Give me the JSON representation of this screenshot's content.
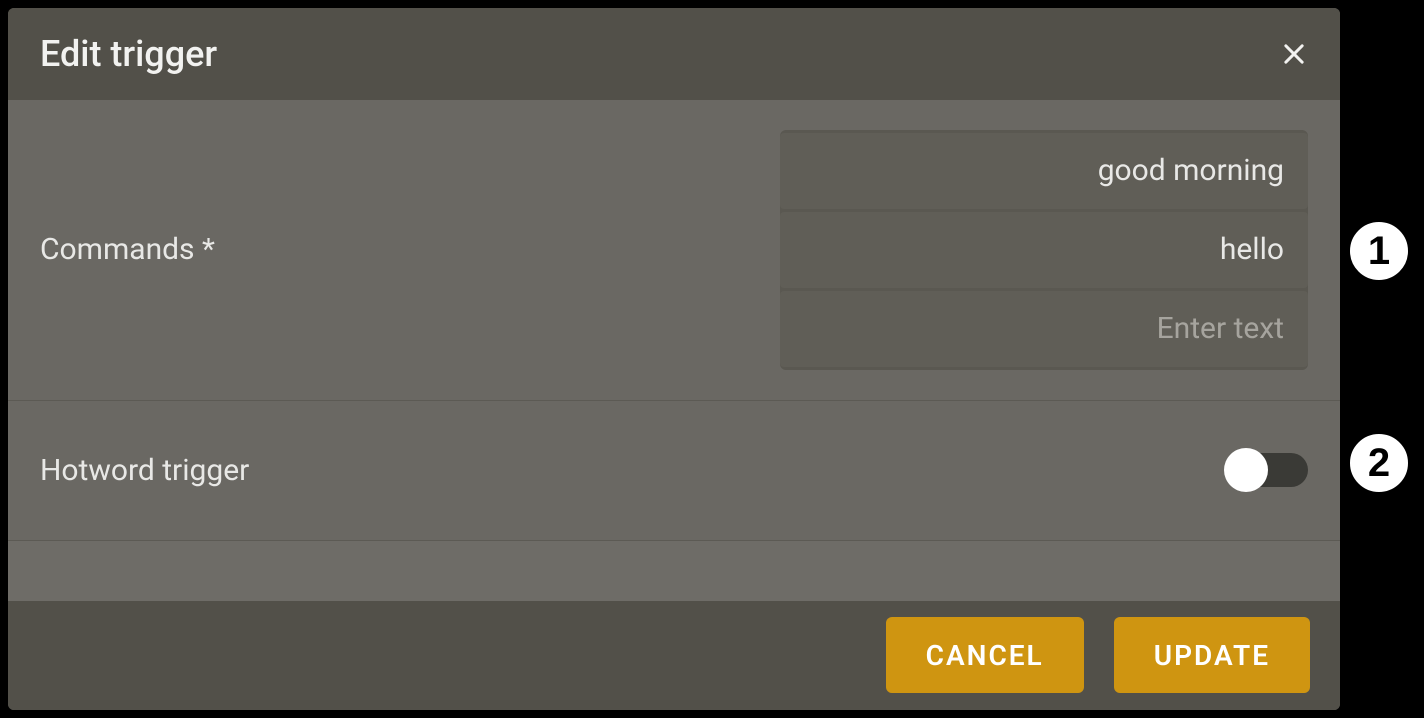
{
  "dialog": {
    "title": "Edit trigger"
  },
  "commands": {
    "label": "Commands *",
    "items": [
      "good morning",
      "hello"
    ],
    "placeholder": "Enter text"
  },
  "hotword": {
    "label": "Hotword trigger",
    "enabled": false
  },
  "footer": {
    "cancel": "CANCEL",
    "update": "UPDATE"
  },
  "annotations": [
    "1",
    "2"
  ]
}
